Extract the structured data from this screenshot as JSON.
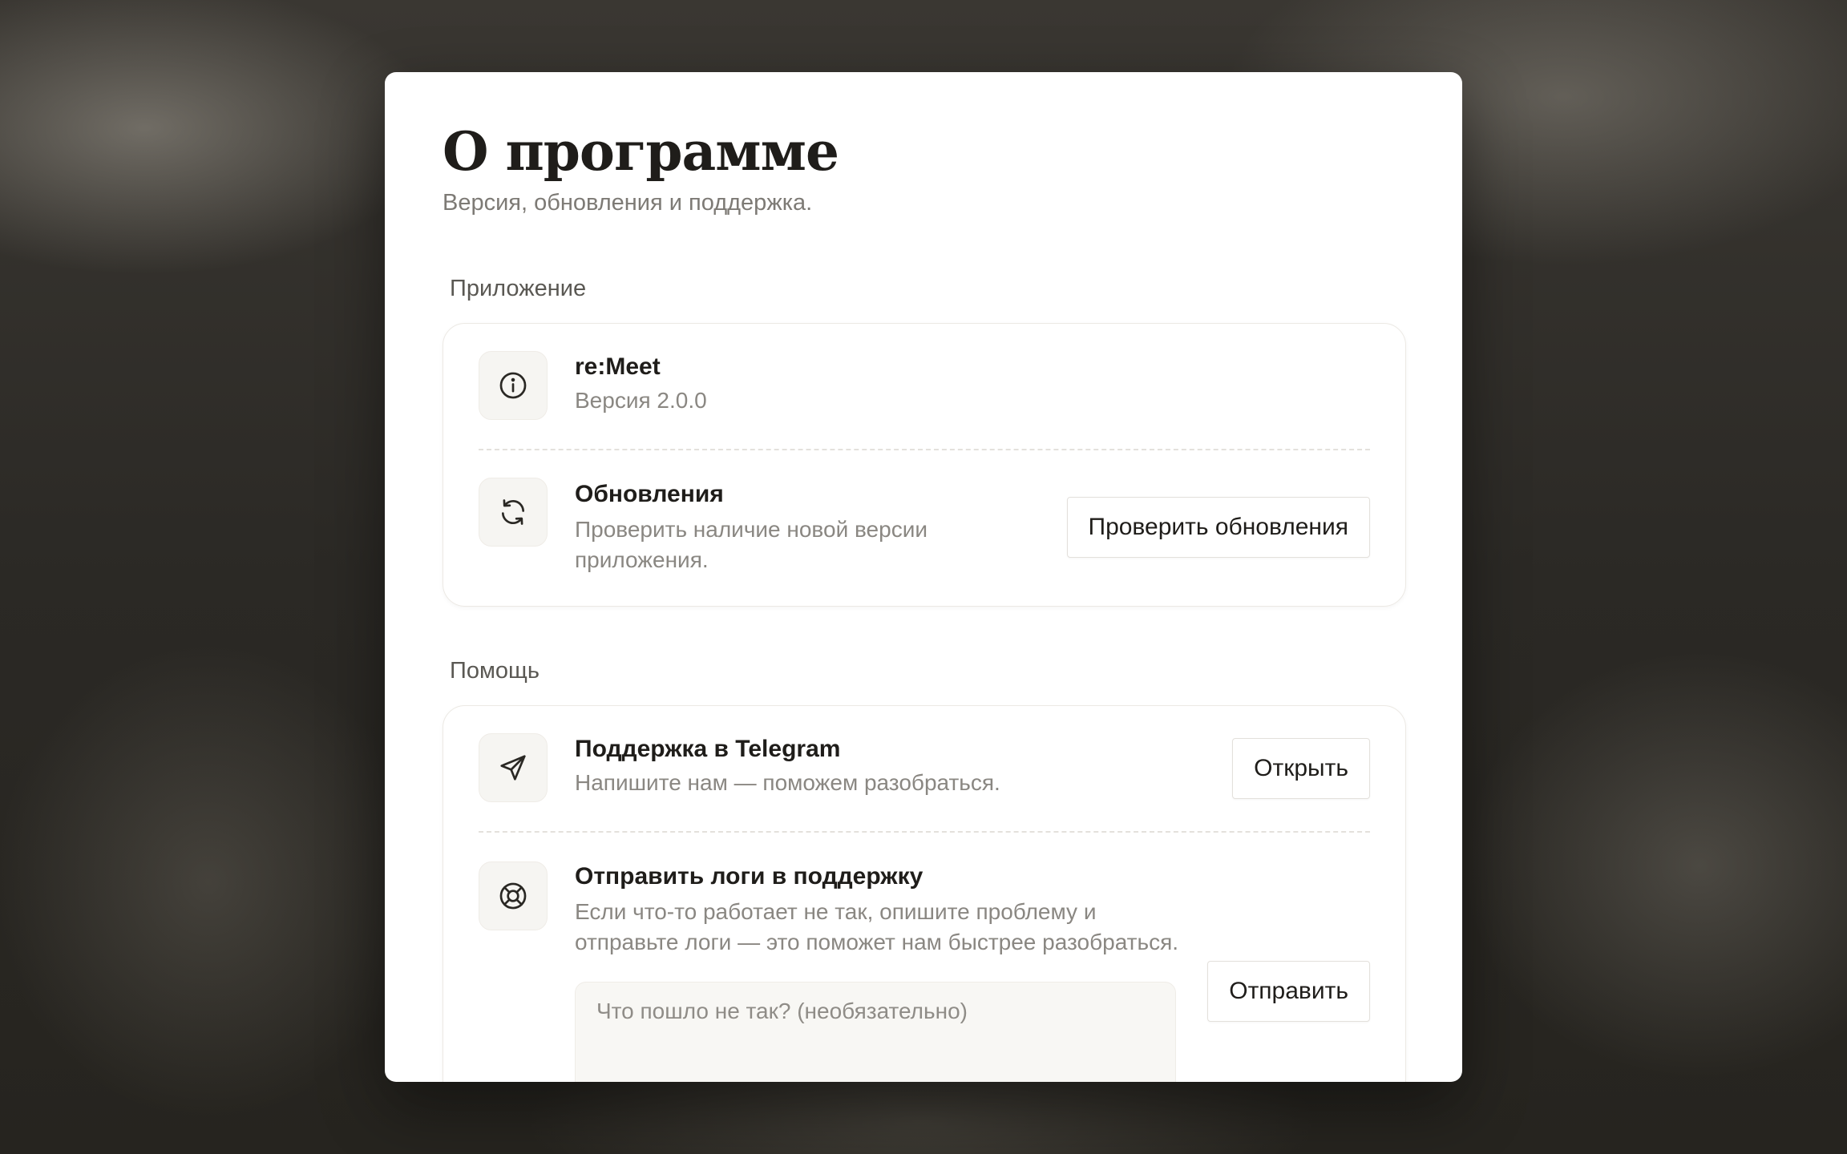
{
  "dialog": {
    "title": "О программе",
    "subtitle": "Версия, обновления и поддержка."
  },
  "sections": [
    {
      "label": "Приложение",
      "rows": [
        {
          "icon": "info-icon",
          "title": "re:Meet",
          "description": "Версия 2.0.0"
        },
        {
          "icon": "refresh-icon",
          "title": "Обновления",
          "description_lines": [
            "Проверить наличие новой версии",
            "приложения."
          ],
          "button": "Проверить обновления"
        }
      ]
    },
    {
      "label": "Помощь",
      "rows": [
        {
          "icon": "send-icon",
          "title": "Поддержка в Telegram",
          "description": "Напишите нам — поможем разобраться.",
          "button": "Открыть"
        },
        {
          "icon": "lifebuoy-icon",
          "title": "Отправить логи в поддержку",
          "description_lines": [
            "Если что-то работает не так, опишите проблему и",
            "отправьте логи — это поможет нам быстрее разобраться."
          ],
          "textarea_placeholder": "Что пошло не так? (необязательно)",
          "textarea_value": "",
          "button": "Отправить"
        }
      ]
    }
  ]
}
